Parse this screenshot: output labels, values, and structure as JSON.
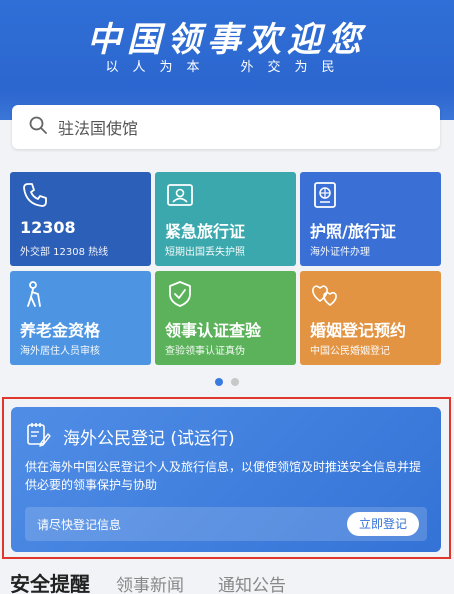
{
  "header": {
    "slogan": "中国领事欢迎您",
    "subslogan": "以人为本　外交为民"
  },
  "search": {
    "placeholder": "驻法国使馆",
    "icon": "search-icon"
  },
  "services": [
    {
      "title": "12308",
      "subtitle": "外交部 12308 热线",
      "icon": "phone-icon",
      "color": "#2c5fb8"
    },
    {
      "title": "紧急旅行证",
      "subtitle": "短期出国丢失护照",
      "icon": "id-card-icon",
      "color": "#3aa8ad"
    },
    {
      "title": "护照/旅行证",
      "subtitle": "海外证件办理",
      "icon": "passport-icon",
      "color": "#3a70d6"
    },
    {
      "title": "养老金资格",
      "subtitle": "海外居住人员审核",
      "icon": "elderly-icon",
      "color": "#4d95e2"
    },
    {
      "title": "领事认证查验",
      "subtitle": "查验领事认证真伪",
      "icon": "shield-check-icon",
      "color": "#5bb25a"
    },
    {
      "title": "婚姻登记预约",
      "subtitle": "中国公民婚姻登记",
      "icon": "hearts-icon",
      "color": "#e39443"
    }
  ],
  "pagination": {
    "total": 2,
    "active": 1
  },
  "registration": {
    "title": "海外公民登记 (试运行)",
    "description": "供在海外中国公民登记个人及旅行信息，以便使领馆及时推送安全信息并提供必要的领事保护与协助",
    "hint": "请尽快登记信息",
    "button": "立即登记"
  },
  "tabs": [
    "安全提醒",
    "领事新闻",
    "通知公告"
  ]
}
